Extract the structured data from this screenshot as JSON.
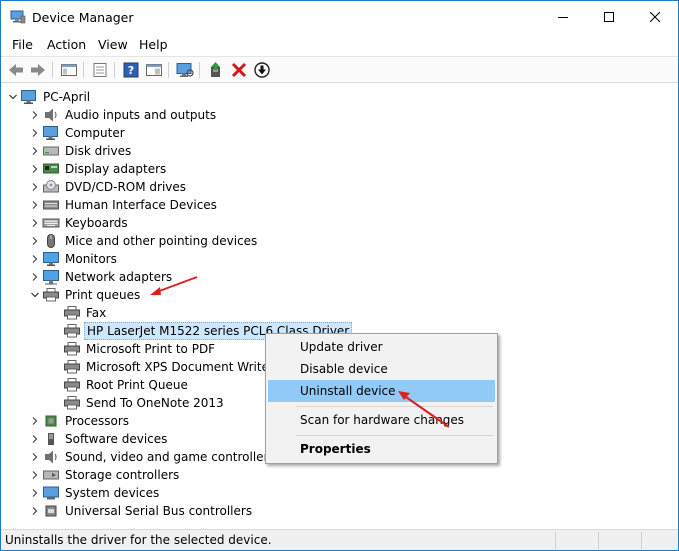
{
  "window": {
    "title": "Device Manager",
    "controls": [
      "minimize-icon",
      "maximize-icon",
      "close-icon"
    ]
  },
  "menu": [
    "File",
    "Action",
    "View",
    "Help"
  ],
  "toolbar": {
    "icons": [
      "back-arrow-icon",
      "forward-arrow-icon",
      "show-hide-console-tree-icon",
      "properties-icon",
      "help-icon",
      "action-pane-icon",
      "scan-hardware-icon",
      "update-driver-icon",
      "uninstall-x-icon",
      "disable-device-icon"
    ]
  },
  "tree": {
    "root": "PC-April",
    "categories": [
      {
        "label": "Audio inputs and outputs",
        "icon": "speaker-icon"
      },
      {
        "label": "Computer",
        "icon": "computer-icon"
      },
      {
        "label": "Disk drives",
        "icon": "disk-drive-icon"
      },
      {
        "label": "Display adapters",
        "icon": "display-adapter-icon"
      },
      {
        "label": "DVD/CD-ROM drives",
        "icon": "dvd-icon"
      },
      {
        "label": "Human Interface Devices",
        "icon": "hid-icon"
      },
      {
        "label": "Keyboards",
        "icon": "keyboard-icon"
      },
      {
        "label": "Mice and other pointing devices",
        "icon": "mouse-icon"
      },
      {
        "label": "Monitors",
        "icon": "monitor-icon"
      },
      {
        "label": "Network adapters",
        "icon": "network-adapter-icon"
      },
      {
        "label": "Print queues",
        "icon": "printer-icon",
        "expanded": true
      }
    ],
    "print_queues": [
      {
        "label": "Fax"
      },
      {
        "label": "HP LaserJet M1522 series PCL6 Class Driver",
        "selected": true
      },
      {
        "label": "Microsoft Print to PDF"
      },
      {
        "label": "Microsoft XPS Document Writer"
      },
      {
        "label": "Root Print Queue"
      },
      {
        "label": "Send To OneNote 2013"
      }
    ],
    "categories_after": [
      {
        "label": "Processors",
        "icon": "processor-icon"
      },
      {
        "label": "Software devices",
        "icon": "software-device-icon"
      },
      {
        "label": "Sound, video and game controllers",
        "icon": "sound-controller-icon"
      },
      {
        "label": "Storage controllers",
        "icon": "storage-controller-icon"
      },
      {
        "label": "System devices",
        "icon": "system-device-icon"
      },
      {
        "label": "Universal Serial Bus controllers",
        "icon": "usb-icon"
      }
    ]
  },
  "context_menu": {
    "items": [
      {
        "label": "Update driver"
      },
      {
        "label": "Disable device"
      },
      {
        "label": "Uninstall device",
        "highlighted": true
      },
      {
        "label": "Scan for hardware changes"
      },
      {
        "label": "Properties",
        "bold": true
      }
    ]
  },
  "status": {
    "text": "Uninstalls the driver for the selected device."
  },
  "colors": {
    "accent_border": "#1979ca",
    "selection": "#cce8ff",
    "menu_highlight": "#91c9f7",
    "annotation_arrow": "#e0201b"
  }
}
